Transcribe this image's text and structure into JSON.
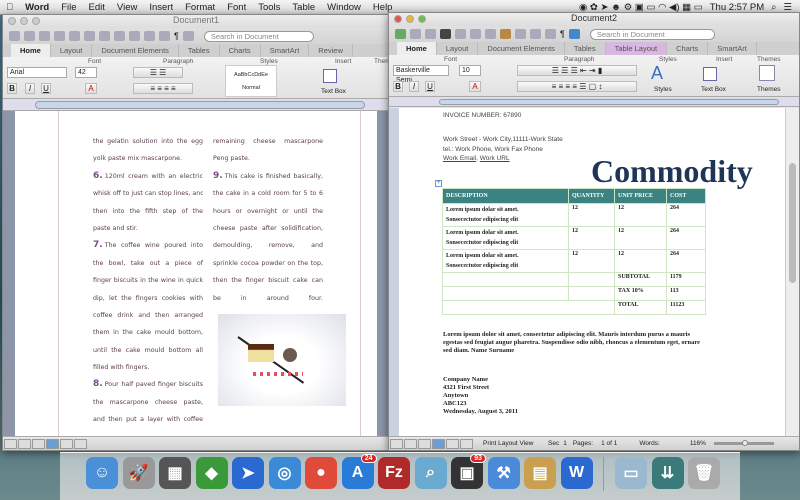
{
  "menubar": {
    "app": "Word",
    "items": [
      "File",
      "Edit",
      "View",
      "Insert",
      "Format",
      "Font",
      "Tools",
      "Table",
      "Window",
      "Help"
    ],
    "clock": "Thu 2:57 PM"
  },
  "doc1": {
    "title": "Document1",
    "search_placeholder": "Search in Document",
    "tabs": [
      "Home",
      "Layout",
      "Document Elements",
      "Tables",
      "Charts",
      "SmartArt",
      "Review"
    ],
    "groups": {
      "font": "Font",
      "paragraph": "Paragraph",
      "styles": "Styles",
      "insert": "Insert",
      "themes": "Themes"
    },
    "font_name": "Arial",
    "font_size": "42",
    "style_preview": "AaBbCcDdEe",
    "style_name": "Normal",
    "textbox_label": "Text Box",
    "themes_label": "Themes",
    "left_col": [
      {
        "num": "",
        "text": "the gelatin solution into the egg"
      },
      {
        "num": "",
        "text": "yolk paste mix mascarpone.",
        "last": true
      },
      {
        "num": "6.",
        "text": "120ml cream with an electric"
      },
      {
        "num": "",
        "text": "whisk off to just can stop lines, and"
      },
      {
        "num": "",
        "text": "then into the fifth step of the"
      },
      {
        "num": "",
        "text": "paste and stir.",
        "last": true
      },
      {
        "num": "7.",
        "text": "The coffee wine poured into"
      },
      {
        "num": "",
        "text": "the bowl, take out a piece of"
      },
      {
        "num": "",
        "text": "finger biscuits in the wine in quick"
      },
      {
        "num": "",
        "text": "dip, let the fingers cookies with"
      },
      {
        "num": "",
        "text": "coffee drink and then arranged"
      },
      {
        "num": "",
        "text": "them in the cake mould bottom,"
      },
      {
        "num": "",
        "text": "until the cake mould bottom all"
      },
      {
        "num": "",
        "text": "filled with fingers.",
        "last": true
      },
      {
        "num": "8.",
        "text": "Pour half paved finger biscuits"
      },
      {
        "num": "",
        "text": "the mascarpone cheese paste,"
      },
      {
        "num": "",
        "text": "and then put a layer with coffee"
      }
    ],
    "right_col": [
      {
        "num": "",
        "text": "remaining cheese mascarpone"
      },
      {
        "num": "",
        "text": "Peng paste.",
        "last": true
      },
      {
        "num": "9.",
        "text": "This cake is finished basically,"
      },
      {
        "num": "",
        "text": "the cake in a cold room for 5 to 6"
      },
      {
        "num": "",
        "text": "hours or overnight or until the"
      },
      {
        "num": "",
        "text": "cheese paste after solidification,"
      },
      {
        "num": "",
        "text": "demoulding, remove, and"
      },
      {
        "num": "",
        "text": "sprinkle cocoa powder on the top,"
      },
      {
        "num": "",
        "text": "then the finger biscuit cake can"
      },
      {
        "num": "",
        "text": "be in around four."
      }
    ]
  },
  "doc2": {
    "title": "Document2",
    "search_placeholder": "Search in Document",
    "tabs": [
      "Home",
      "Layout",
      "Document Elements",
      "Tables",
      "Table Layout",
      "Charts",
      "SmartArt"
    ],
    "font_name": "Baskerville Semi...",
    "font_size": "10",
    "styles_label": "Styles",
    "textbox_label": "Text Box",
    "themes_label": "Themes",
    "invoice_number": "INVOICE NUMBER: 67890",
    "address": "Work Street - Work City,11111-Work State",
    "tel": "tel.: Work Phone, Work Fax Phone",
    "email": "Work Email",
    "url": "Work URL",
    "heading": "Commodity",
    "table": {
      "headers": [
        "DESCRIPTION",
        "QUANTITY",
        "UNIT PRICE",
        "COST"
      ],
      "rows": [
        [
          "Lorem ipsum dolar sit amet.",
          "Sonsecectutor edipiscing elit",
          "12",
          "12",
          "264"
        ],
        [
          "Lorem ipsum dolar sit amet.",
          "Sonsecectutor edipiscing elit",
          "12",
          "12",
          "264"
        ],
        [
          "Lorem ipsum dolar sit amet.",
          "Sonsecectutor edipiscing elit",
          "12",
          "12",
          "264"
        ]
      ],
      "subtotal_label": "SUBTOTAL",
      "subtotal": "1179",
      "tax_label": "TAX 10%",
      "tax": "113",
      "total_label": "TOTAL",
      "total": "11123"
    },
    "paragraph": "Lorem ipsum dolor sit amet, consectetur adipiscing elit. Mauris interdum purus a mauris egestas sed feugiat augue pharetra. Suspendisse odio nibh, rhoncus a elementum eget, ornare sed diam. Name Surname",
    "company": [
      "Company Name",
      "4321 First Street",
      "Anytown",
      "ABC123",
      "Wednesday, August 3, 2011"
    ],
    "status": {
      "view": "Print Layout View",
      "sec_label": "Sec",
      "sec": "1",
      "pages_label": "Pages:",
      "pages": "1 of 1",
      "words_label": "Words:",
      "zoom": "116%"
    }
  },
  "dock": {
    "appstore_badge": "24",
    "app93_badge": "93"
  }
}
